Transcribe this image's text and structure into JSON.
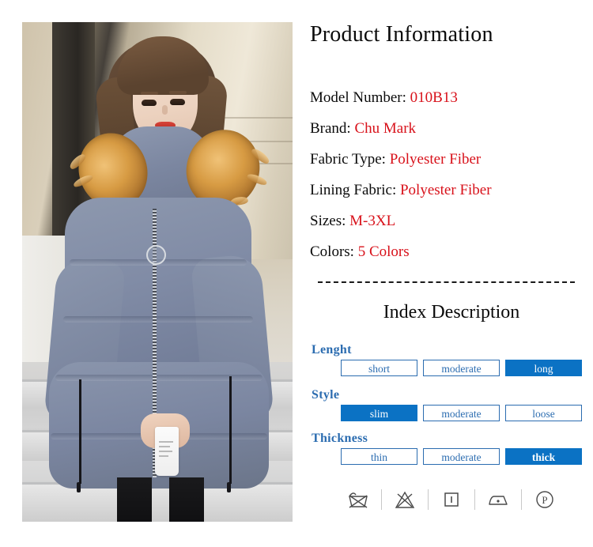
{
  "header": {
    "title": "Product Information"
  },
  "specs": [
    {
      "label": "Model Number:",
      "value": "010B13"
    },
    {
      "label": "Brand:",
      "value": "Chu Mark"
    },
    {
      "label": "Fabric Type:",
      "value": "Polyester Fiber"
    },
    {
      "label": "Lining Fabric:",
      "value": "Polyester Fiber"
    },
    {
      "label": "Sizes:",
      "value": "M-3XL"
    },
    {
      "label": "Colors:",
      "value": "5 Colors"
    }
  ],
  "index": {
    "subtitle": "Index Description",
    "rows": [
      {
        "label": "Lenght",
        "options": [
          {
            "text": "short",
            "selected": false
          },
          {
            "text": "moderate",
            "selected": false
          },
          {
            "text": "long",
            "selected": true
          }
        ]
      },
      {
        "label": "Style",
        "options": [
          {
            "text": "slim",
            "selected": true
          },
          {
            "text": "moderate",
            "selected": false
          },
          {
            "text": "loose",
            "selected": false
          }
        ]
      },
      {
        "label": "Thickness",
        "options": [
          {
            "text": "thin",
            "selected": false
          },
          {
            "text": "moderate",
            "selected": false
          },
          {
            "text": "thick",
            "selected": true
          }
        ]
      }
    ]
  },
  "care_symbols": [
    {
      "name": "do-not-wash-icon",
      "title": "Do not wash"
    },
    {
      "name": "do-not-bleach-icon",
      "title": "Do not bleach"
    },
    {
      "name": "drip-dry-icon",
      "title": "Drip dry"
    },
    {
      "name": "iron-low-heat-icon",
      "title": "Iron low heat"
    },
    {
      "name": "dry-clean-p-icon",
      "title": "Professional dry clean (P)"
    }
  ],
  "product_photo": {
    "alt": "Model wearing grey-blue hooded puffer coat with tan fur trim"
  },
  "colors": {
    "accent_blue": "#0b72c4",
    "label_blue": "#2b6cb0",
    "value_red": "#d8111a",
    "text_black": "#0b0b0b",
    "coat_grey_blue": "#7b86a0",
    "fur_tan": "#d79b43"
  }
}
